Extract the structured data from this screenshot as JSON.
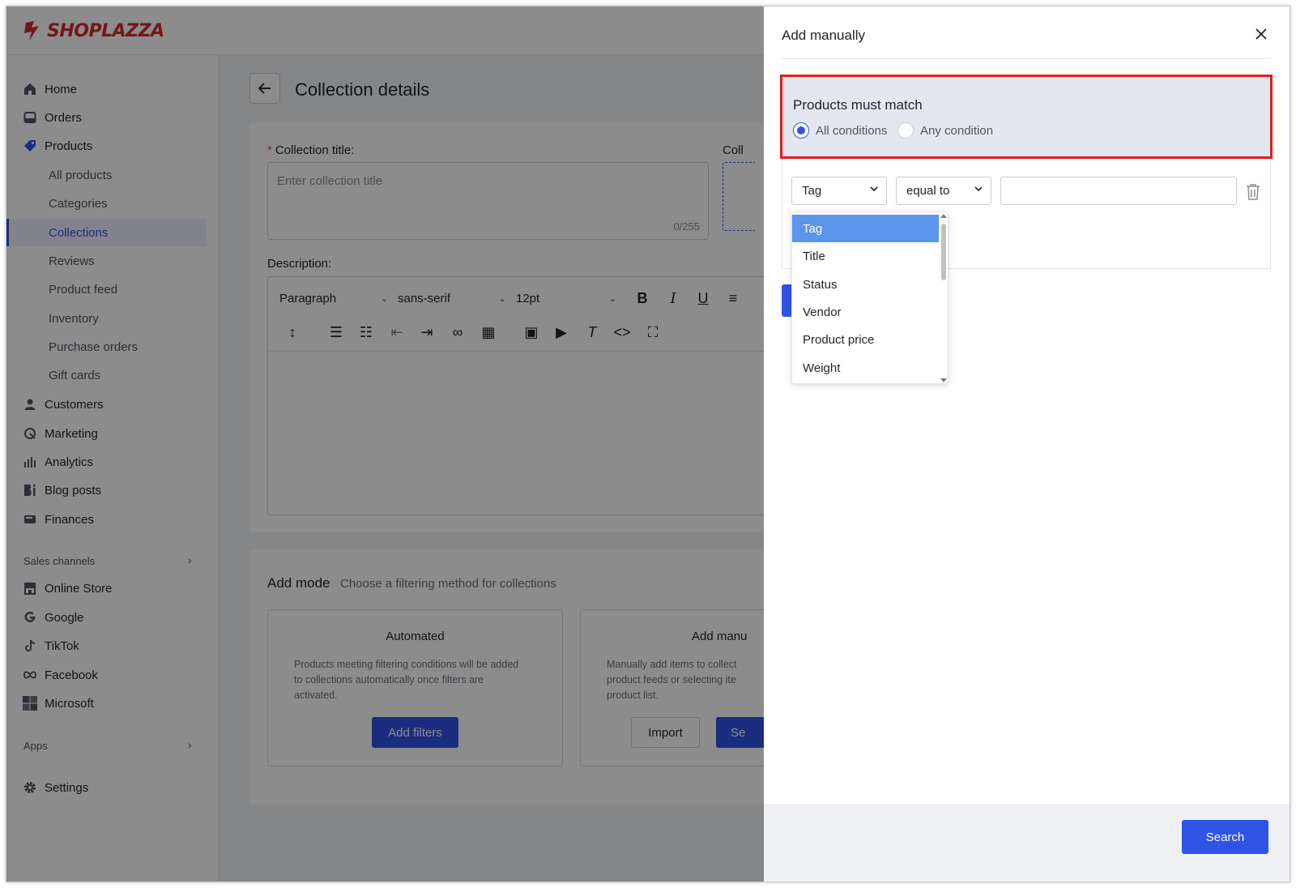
{
  "brand": {
    "name": "SHOPLAZZA",
    "color": "#d6282e"
  },
  "accent_color": "#3053e6",
  "sidebar": {
    "items": [
      {
        "label": "Home",
        "icon": "home-icon"
      },
      {
        "label": "Orders",
        "icon": "inbox-icon"
      },
      {
        "label": "Products",
        "icon": "tag-icon"
      }
    ],
    "product_subitems": [
      "All products",
      "Categories",
      "Collections",
      "Reviews",
      "Product feed",
      "Inventory",
      "Purchase orders",
      "Gift cards"
    ],
    "active_subitem": "Collections",
    "items2": [
      {
        "label": "Customers",
        "icon": "user-icon"
      },
      {
        "label": "Marketing",
        "icon": "marketing-icon"
      },
      {
        "label": "Analytics",
        "icon": "bar-chart-icon"
      },
      {
        "label": "Blog posts",
        "icon": "blog-icon"
      },
      {
        "label": "Finances",
        "icon": "wallet-icon"
      }
    ],
    "sales_channels_title": "Sales channels",
    "channels": [
      {
        "label": "Online Store",
        "icon": "store-icon"
      },
      {
        "label": "Google",
        "icon": "google-icon"
      },
      {
        "label": "TikTok",
        "icon": "tiktok-icon"
      },
      {
        "label": "Facebook",
        "icon": "meta-icon"
      },
      {
        "label": "Microsoft",
        "icon": "microsoft-icon"
      }
    ],
    "apps_title": "Apps",
    "settings_label": "Settings"
  },
  "page": {
    "title": "Collection details",
    "collection_title_label": "Collection title:",
    "collection_title_placeholder": "Enter collection title",
    "collection_title_counter": "0/255",
    "cut_label": "Coll",
    "description_label": "Description:",
    "editor": {
      "paragraph": "Paragraph",
      "font": "sans-serif",
      "size": "12pt"
    },
    "add_mode_title": "Add mode",
    "add_mode_subtitle": "Choose a filtering method for collections",
    "automated": {
      "title": "Automated",
      "desc": "Products meeting filtering conditions will be added to collections automatically once filters are activated.",
      "button": "Add filters"
    },
    "manual": {
      "title": "Add manu",
      "desc": "Manually add items to collect product feeds or selecting ite product list.",
      "import_button": "Import",
      "select_button": "Se"
    }
  },
  "drawer": {
    "title": "Add manually",
    "match_title": "Products must match",
    "option_all": "All conditions",
    "option_any": "Any condition",
    "selected_option": "All conditions",
    "field_select": "Tag",
    "operator_select": "equal to",
    "value": "",
    "dropdown_options": [
      "Tag",
      "Title",
      "Status",
      "Vendor",
      "Product price",
      "Weight"
    ],
    "dropdown_selected": "Tag",
    "search_button": "Search"
  }
}
